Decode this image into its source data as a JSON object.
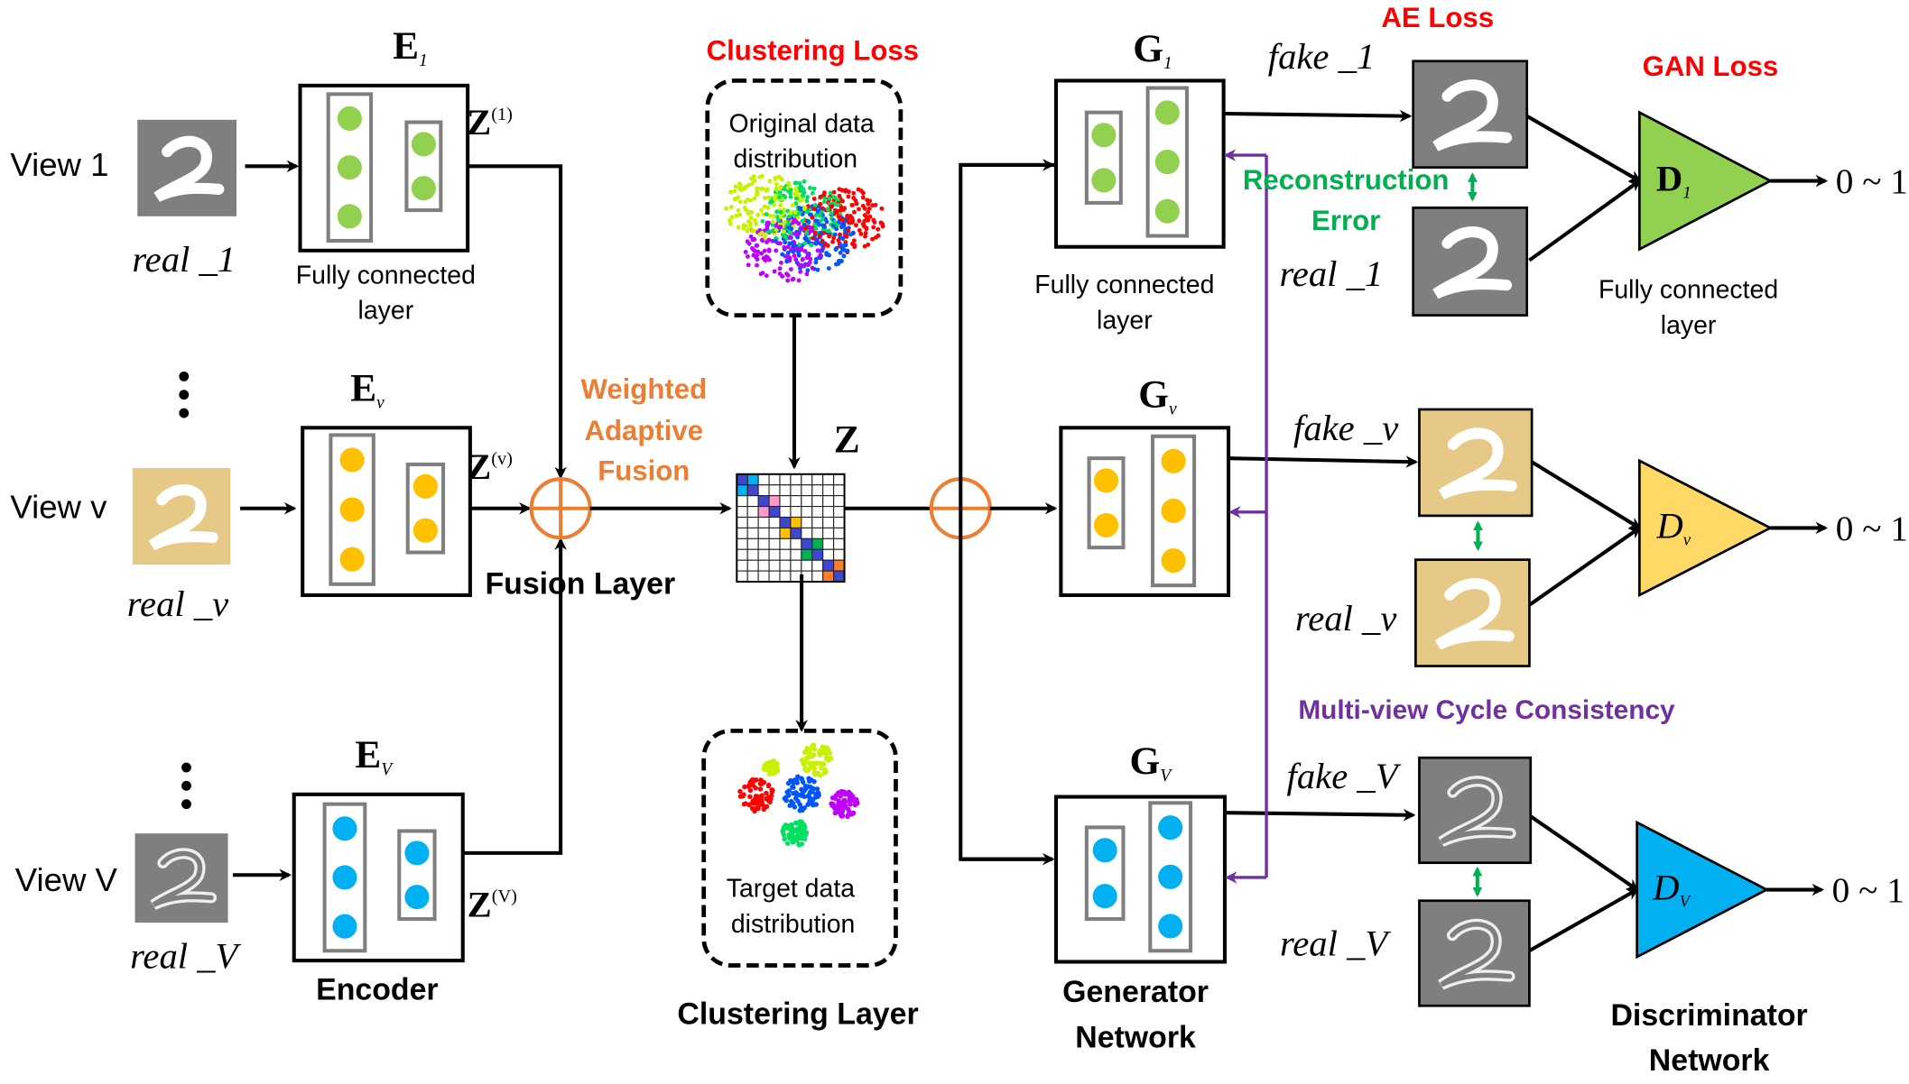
{
  "encoders": [
    {
      "view_label": "View 1",
      "real_label": "real _1",
      "name": "E",
      "sub": "1",
      "z": "Z",
      "z_sup": "(1)",
      "node_color": "#92d050",
      "image_style": "gray",
      "fc_line1": "Fully connected",
      "fc_line2": "layer"
    },
    {
      "view_label": "View v",
      "real_label": "real _v",
      "name": "E",
      "sub": "v",
      "z": "Z",
      "z_sup": "(v)",
      "node_color": "#ffc000",
      "image_style": "tan"
    },
    {
      "view_label": "View V",
      "real_label": "real _V",
      "name": "E",
      "sub": "V",
      "z": "Z",
      "z_sup": "(V)",
      "node_color": "#00b0f0",
      "image_style": "gray-outline"
    }
  ],
  "encoder_title": "Encoder",
  "fusion": {
    "title": "Fusion Layer",
    "weighted_line1": "Weighted",
    "weighted_line2": "Adaptive",
    "weighted_line3": "Fusion",
    "color": "#ed7d31"
  },
  "clustering": {
    "loss_label": "Clustering Loss",
    "original_line1": "Original data",
    "original_line2": "distribution",
    "target_line1": "Target data",
    "target_line2": "distribution",
    "z_label": "Z",
    "title": "Clustering Layer",
    "matrix_block_colors": [
      "#00b0f0",
      "#ff99cc",
      "#ffc000",
      "#00b050",
      "#ff7f27"
    ],
    "matrix_diag_color": "#3f48cc"
  },
  "generators": [
    {
      "name": "G",
      "sub": "1",
      "fake_label": "fake _1",
      "real_label": "real _1",
      "fc_line1": "Fully connected",
      "fc_line2": "layer"
    },
    {
      "name": "G",
      "sub": "v",
      "fake_label": "fake _v",
      "real_label": "real _v"
    },
    {
      "name": "G",
      "sub": "V",
      "fake_label": "fake _V",
      "real_label": "real _V"
    }
  ],
  "generator_title_line1": "Generator",
  "generator_title_line2": "Network",
  "losses": {
    "ae": "AE Loss",
    "gan": "GAN Loss",
    "recon_line1": "Reconstruction",
    "recon_line2": "Error",
    "cycle": "Multi-view Cycle Consistency",
    "red": "#ff0000",
    "green": "#00b050",
    "purple": "#7030a0"
  },
  "discriminators": [
    {
      "name": "D",
      "sub": "1",
      "output": "0 ~ 1",
      "color": "#92d050",
      "fc_line1": "Fully connected",
      "fc_line2": "layer"
    },
    {
      "name": "D",
      "sub": "v",
      "output": "0 ~ 1",
      "color": "#ffd966"
    },
    {
      "name": "D",
      "sub": "V",
      "output": "0 ~ 1",
      "color": "#00b0f0"
    }
  ],
  "discriminator_title_line1": "Discriminator",
  "discriminator_title_line2": "Network"
}
